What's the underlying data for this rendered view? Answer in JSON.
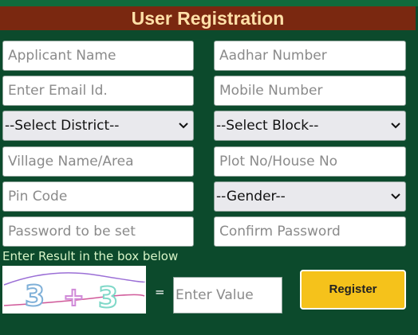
{
  "form": {
    "title": "User Registration",
    "applicant_name_placeholder": "Applicant Name",
    "aadhar_placeholder": "Aadhar Number",
    "email_placeholder": "Enter Email Id.",
    "mobile_placeholder": "Mobile Number",
    "district_selected": "--Select District--",
    "block_selected": "--Select Block--",
    "village_placeholder": "Village Name/Area",
    "plot_placeholder": "Plot No/House No",
    "pin_placeholder": "Pin Code",
    "gender_selected": "--Gender--",
    "password_placeholder": "Password to be set",
    "confirm_password_placeholder": "Confirm Password"
  },
  "captcha": {
    "instruction": "Enter Result in the box below",
    "expression": [
      "3",
      "+",
      "3"
    ],
    "equals": "=",
    "value_placeholder": "Enter Value"
  },
  "actions": {
    "register_label": "Register"
  },
  "colors": {
    "background": "#0c4a2c",
    "title_bar": "#7a2810",
    "title_text": "#ffe0a8",
    "button": "#f5c21b"
  },
  "icons": {
    "dropdown": "chevron-down-icon"
  }
}
